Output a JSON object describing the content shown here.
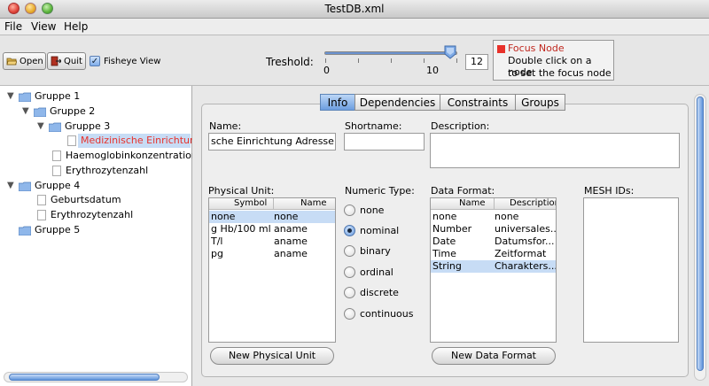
{
  "window": {
    "title": "TestDB.xml"
  },
  "menu": {
    "file": "File",
    "view": "View",
    "help": "Help"
  },
  "toolbar": {
    "open_label": "Open",
    "quit_label": "Quit",
    "fisheye_label": "Fisheye View",
    "fisheye_checked": true,
    "threshold_label": "Treshold:",
    "slider_min_label": "0",
    "slider_mid_label": "10",
    "slider_value": "12",
    "slider_fraction": 0.93
  },
  "legend": {
    "title": "Focus Node",
    "line1": "Double click on a node",
    "line2": "to set the focus node",
    "focus_color": "#e8312a"
  },
  "tree": {
    "nodes": [
      {
        "label": "Gruppe 1",
        "type": "folder",
        "expanded": true
      },
      {
        "label": "Gruppe 2",
        "type": "folder",
        "expanded": true
      },
      {
        "label": "Gruppe 3",
        "type": "folder",
        "expanded": true
      },
      {
        "label": "Medizinische Einrichtung",
        "type": "doc",
        "selected": true
      },
      {
        "label": "Haemoglobinkonzentration",
        "type": "doc"
      },
      {
        "label": "Erythrozytenzahl",
        "type": "doc"
      },
      {
        "label": "Gruppe 4",
        "type": "folder",
        "expanded": true
      },
      {
        "label": "Geburtsdatum",
        "type": "doc"
      },
      {
        "label": "Erythrozytenzahl",
        "type": "doc"
      },
      {
        "label": "Gruppe 5",
        "type": "folder",
        "expanded": false
      }
    ]
  },
  "tabs": [
    "Info",
    "Dependencies",
    "Constraints",
    "Groups"
  ],
  "selected_tab": "Info",
  "info": {
    "name_label": "Name:",
    "name_value": "sche Einrichtung Adresse",
    "shortname_label": "Shortname:",
    "shortname_value": "",
    "description_label": "Description:",
    "description_value": "",
    "physical_unit_label": "Physical Unit:",
    "physical_unit_columns": [
      "Symbol",
      "Name"
    ],
    "physical_unit_rows": [
      [
        "none",
        "none"
      ],
      [
        "g Hb/100 ml",
        "aname"
      ],
      [
        "T/l",
        "aname"
      ],
      [
        "pg",
        "aname"
      ]
    ],
    "physical_unit_selected": 0,
    "numeric_type_label": "Numeric Type:",
    "numeric_types": [
      "none",
      "nominal",
      "binary",
      "ordinal",
      "discrete",
      "continuous"
    ],
    "numeric_type_selected": "nominal",
    "data_format_label": "Data Format:",
    "data_format_columns": [
      "Name",
      "Description"
    ],
    "data_format_rows": [
      [
        "none",
        "none"
      ],
      [
        "Number",
        "universales..."
      ],
      [
        "Date",
        "Datumsfor..."
      ],
      [
        "Time",
        "Zeitformat"
      ],
      [
        "String",
        "Charakters..."
      ]
    ],
    "data_format_selected": 4,
    "mesh_label": "MESH IDs:",
    "new_unit_button": "New Physical Unit",
    "new_format_button": "New Data Format"
  }
}
